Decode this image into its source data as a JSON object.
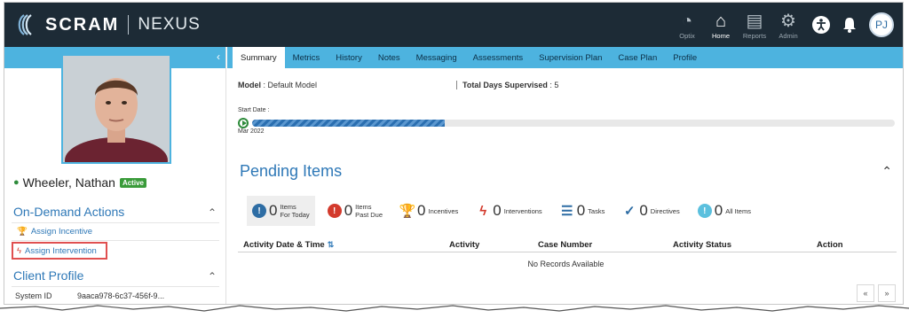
{
  "header": {
    "logo_brand": "SCRAM",
    "logo_product": "NEXUS",
    "nav": [
      {
        "label": "Optix",
        "icon": "gauge-icon"
      },
      {
        "label": "Home",
        "icon": "home-icon"
      },
      {
        "label": "Reports",
        "icon": "document-icon"
      },
      {
        "label": "Admin",
        "icon": "gears-icon"
      }
    ],
    "user_initials": "PJ"
  },
  "sidebar": {
    "client_name": "Wheeler, Nathan",
    "status_badge": "Active",
    "on_demand_title": "On-Demand Actions",
    "actions": [
      {
        "label": "Assign Incentive",
        "icon": "trophy-icon"
      },
      {
        "label": "Assign Intervention",
        "icon": "lightning-icon"
      }
    ],
    "client_profile_title": "Client Profile",
    "system_id_label": "System ID",
    "system_id_value": "9aaca978-6c37-456f-9..."
  },
  "tabs": [
    "Summary",
    "Metrics",
    "History",
    "Notes",
    "Messaging",
    "Assessments",
    "Supervision Plan",
    "Case Plan",
    "Profile"
  ],
  "active_tab": "Summary",
  "summary": {
    "model_label": "Model",
    "model_value": ": Default Model",
    "total_days_label": "Total Days Supervised",
    "total_days_value": ": 5",
    "start_date_label": "Start Date :",
    "start_month": "Mar 2022",
    "progress_fraction": 0.3
  },
  "pending": {
    "title": "Pending Items",
    "filters": [
      {
        "count": "0",
        "label1": "Items",
        "label2": "For Today",
        "color": "#2e6da4",
        "glyph": "!"
      },
      {
        "count": "0",
        "label1": "Items",
        "label2": "Past Due",
        "color": "#d33a2c",
        "glyph": "!"
      },
      {
        "count": "0",
        "label1": "",
        "label2": "Incentives",
        "color": "#2e8b3b",
        "glyph": "🏆"
      },
      {
        "count": "0",
        "label1": "",
        "label2": "Interventions",
        "color": "#d33a2c",
        "glyph": "ϟ"
      },
      {
        "count": "0",
        "label1": "",
        "label2": "Tasks",
        "color": "#2e6da4",
        "glyph": "☰"
      },
      {
        "count": "0",
        "label1": "",
        "label2": "Directives",
        "color": "#2e6da4",
        "glyph": "✓"
      },
      {
        "count": "0",
        "label1": "",
        "label2": "All Items",
        "color": "#5bc0de",
        "glyph": "!"
      }
    ],
    "columns": [
      "Activity Date & Time",
      "Activity",
      "Case Number",
      "Activity Status",
      "Action"
    ],
    "empty_text": "No Records Available",
    "pager_prev": "«",
    "pager_next": "»"
  }
}
